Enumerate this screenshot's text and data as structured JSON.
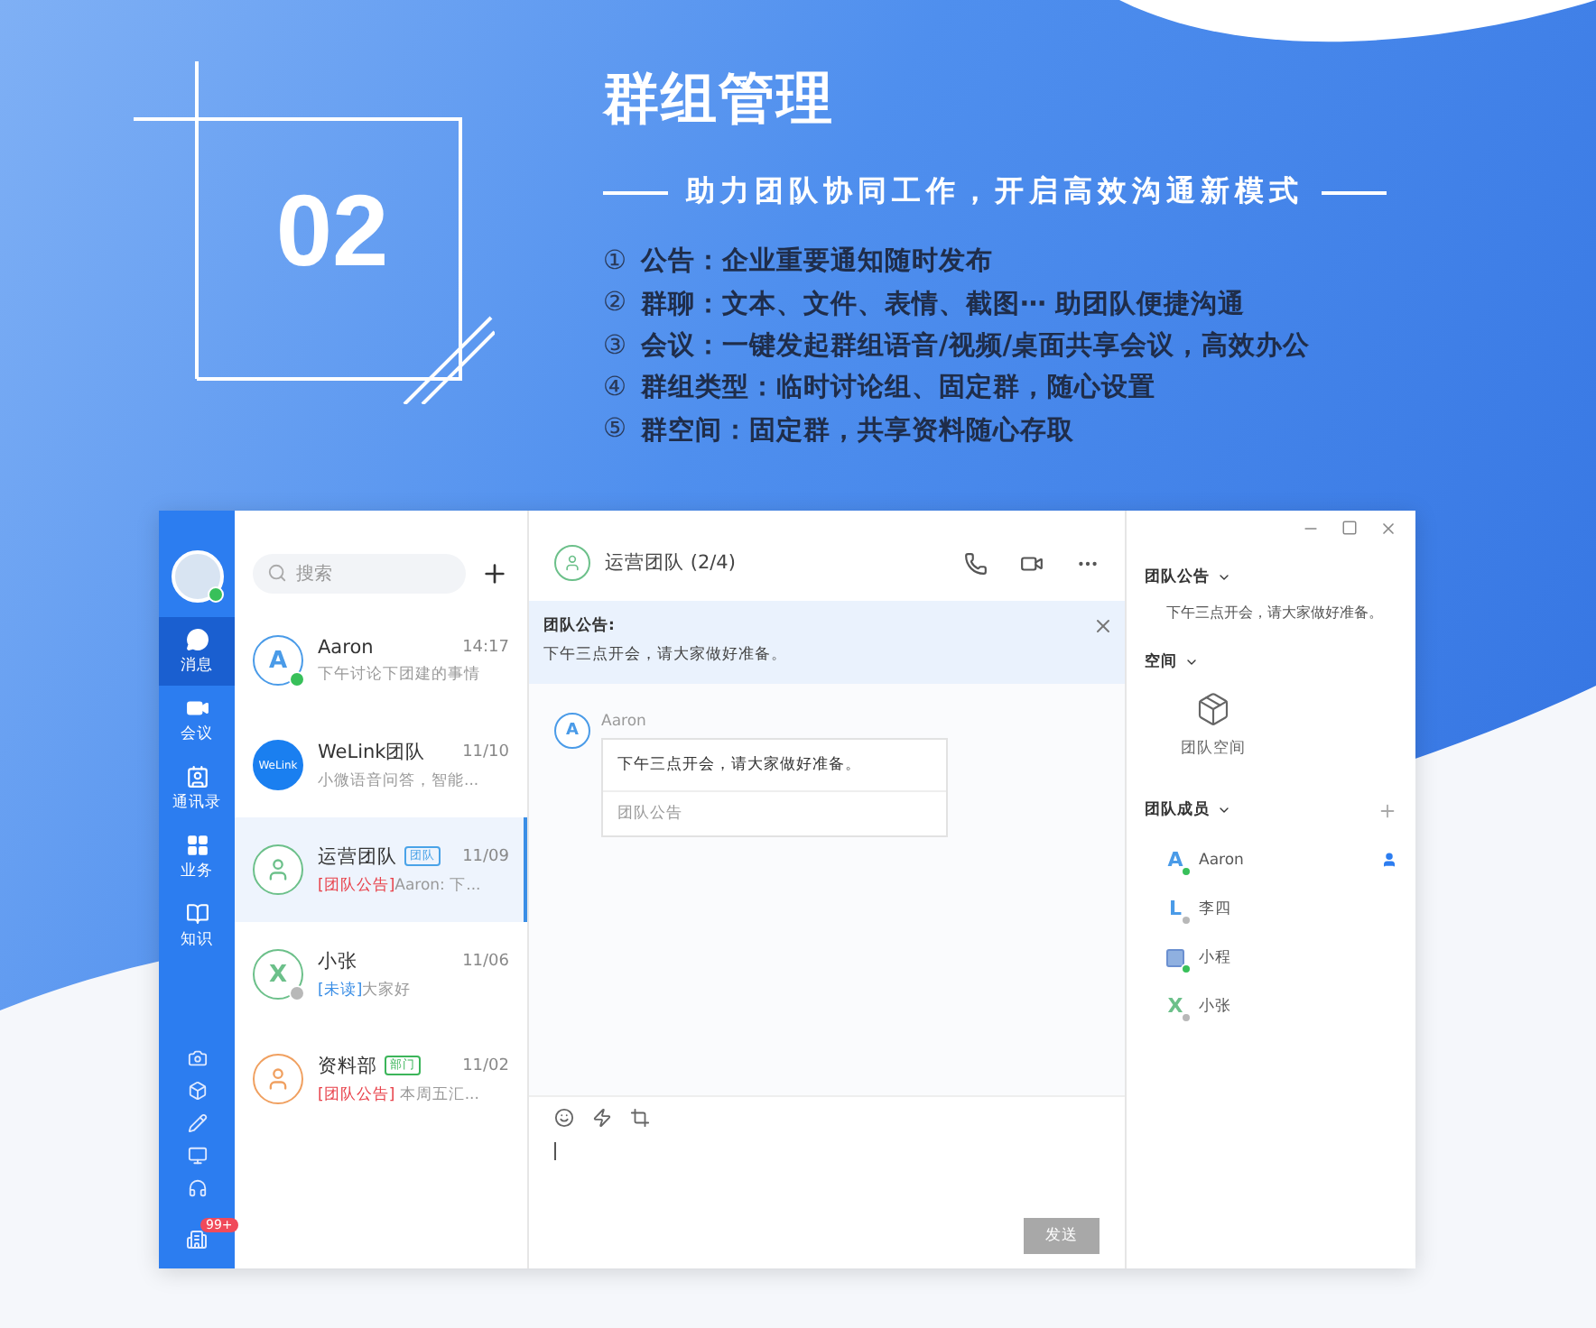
{
  "banner": {
    "number": "02",
    "title": "群组管理",
    "subtitle": "助力团队协同工作，开启高效沟通新模式",
    "features": [
      {
        "num": "①",
        "text": "公告：企业重要通知随时发布"
      },
      {
        "num": "②",
        "text": "群聊：文本、文件、表情、截图⋯ 助团队便捷沟通"
      },
      {
        "num": "③",
        "text": "会议：一键发起群组语音/视频/桌面共享会议，高效办公"
      },
      {
        "num": "④",
        "text": "群组类型：临时讨论组、固定群，随心设置"
      },
      {
        "num": "⑤",
        "text": "群空间：固定群，共享资料随心存取"
      }
    ]
  },
  "app": {
    "rail": {
      "items": [
        {
          "label": "消息",
          "selected": true
        },
        {
          "label": "会议",
          "selected": false
        },
        {
          "label": "通讯录",
          "selected": false
        },
        {
          "label": "业务",
          "selected": false
        },
        {
          "label": "知识",
          "selected": false
        }
      ],
      "badge": "99+"
    },
    "search": {
      "placeholder": "搜索"
    },
    "conversations": [
      {
        "name": "Aaron",
        "avatar": {
          "kind": "letter",
          "text": "A"
        },
        "time": "14:17",
        "preview": "下午讨论下团建的事情",
        "online": true,
        "selected": false
      },
      {
        "name": "WeLink团队",
        "avatar": {
          "kind": "brand",
          "text": "WeLink"
        },
        "time": "11/10",
        "preview": "小微语音问答，智能...",
        "selected": false
      },
      {
        "name": "运营团队",
        "avatar": {
          "kind": "group",
          "color": "#6cc08a"
        },
        "tag": {
          "kind": "team",
          "text": "团队"
        },
        "time": "11/09",
        "prefix": {
          "kind": "notice",
          "text": "[团队公告]"
        },
        "preview": "Aaron: 下...",
        "selected": true
      },
      {
        "name": "小张",
        "avatar": {
          "kind": "letter",
          "text": "X"
        },
        "time": "11/06",
        "prefix": {
          "kind": "unread",
          "text": "[未读]"
        },
        "preview": "大家好",
        "online": false,
        "selected": false
      },
      {
        "name": "资料部",
        "avatar": {
          "kind": "group",
          "color": "#f0a060"
        },
        "tag": {
          "kind": "dept",
          "text": "部门"
        },
        "time": "11/02",
        "prefix": {
          "kind": "notice",
          "text": "[团队公告]"
        },
        "preview": " 本周五汇...",
        "selected": false
      }
    ],
    "chat": {
      "title": "运营团队",
      "count": "(2/4)",
      "notice": {
        "title": "团队公告:",
        "text": "下午三点开会，请大家做好准备。"
      },
      "message": {
        "avatar": "A",
        "sender": "Aaron",
        "text": "下午三点开会，请大家做好准备。",
        "footer": "团队公告"
      },
      "send": "发送"
    },
    "details": {
      "notice": {
        "title": "团队公告",
        "text": "下午三点开会，请大家做好准备。"
      },
      "space": {
        "title": "空间",
        "item": "团队空间"
      },
      "members": {
        "title": "团队成员",
        "list": [
          {
            "name": "Aaron",
            "avatar": {
              "kind": "letter",
              "text": "A"
            },
            "online": true,
            "owner": true
          },
          {
            "name": "李四",
            "avatar": {
              "kind": "letter",
              "text": "L"
            },
            "online": false,
            "owner": false
          },
          {
            "name": "小程",
            "avatar": {
              "kind": "photo"
            },
            "online": true,
            "owner": false
          },
          {
            "name": "小张",
            "avatar": {
              "kind": "letter",
              "text": "X"
            },
            "online": false,
            "owner": false
          }
        ]
      }
    }
  }
}
